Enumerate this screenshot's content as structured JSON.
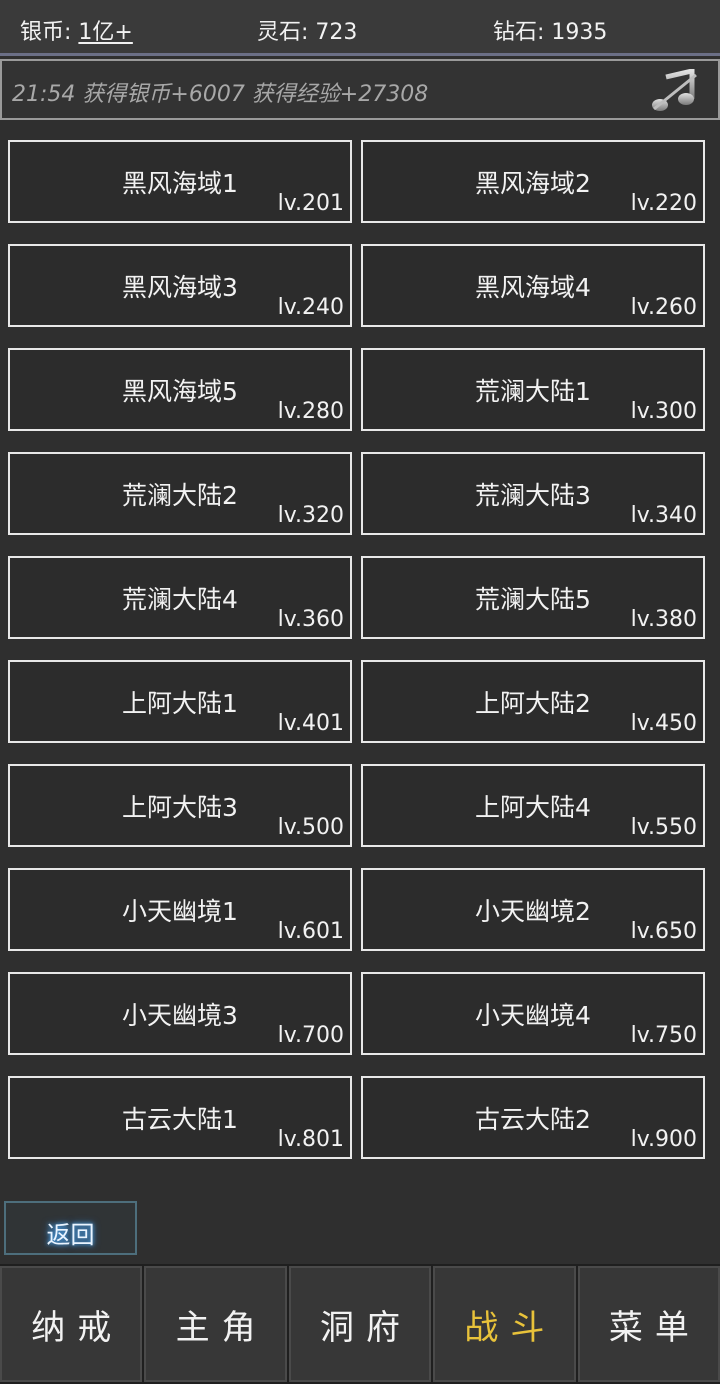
{
  "currencies": {
    "silver": {
      "label": "银币: ",
      "value": "1亿+"
    },
    "spirit_stone": {
      "label": "灵石: ",
      "value": "723"
    },
    "diamond": {
      "label": "钻石: ",
      "value": "1935"
    }
  },
  "log": {
    "text": "21:54 获得银币+6007 获得经验+27308",
    "music_icon": "music-muted-icon"
  },
  "zones": [
    {
      "name": "黑风海域1",
      "level": "lv.201"
    },
    {
      "name": "黑风海域2",
      "level": "lv.220"
    },
    {
      "name": "黑风海域3",
      "level": "lv.240"
    },
    {
      "name": "黑风海域4",
      "level": "lv.260"
    },
    {
      "name": "黑风海域5",
      "level": "lv.280"
    },
    {
      "name": "荒澜大陆1",
      "level": "lv.300"
    },
    {
      "name": "荒澜大陆2",
      "level": "lv.320"
    },
    {
      "name": "荒澜大陆3",
      "level": "lv.340"
    },
    {
      "name": "荒澜大陆4",
      "level": "lv.360"
    },
    {
      "name": "荒澜大陆5",
      "level": "lv.380"
    },
    {
      "name": "上阿大陆1",
      "level": "lv.401"
    },
    {
      "name": "上阿大陆2",
      "level": "lv.450"
    },
    {
      "name": "上阿大陆3",
      "level": "lv.500"
    },
    {
      "name": "上阿大陆4",
      "level": "lv.550"
    },
    {
      "name": "小天幽境1",
      "level": "lv.601"
    },
    {
      "name": "小天幽境2",
      "level": "lv.650"
    },
    {
      "name": "小天幽境3",
      "level": "lv.700"
    },
    {
      "name": "小天幽境4",
      "level": "lv.750"
    },
    {
      "name": "古云大陆1",
      "level": "lv.801"
    },
    {
      "name": "古云大陆2",
      "level": "lv.900"
    }
  ],
  "back_label": "返回",
  "nav": {
    "tabs": [
      "纳戒",
      "主角",
      "洞府",
      "战斗",
      "菜单"
    ],
    "active_index": 3
  },
  "colors": {
    "background": "#2f2f2f",
    "active_tab": "#e8c23a",
    "back_glow": "#59b8ff"
  }
}
